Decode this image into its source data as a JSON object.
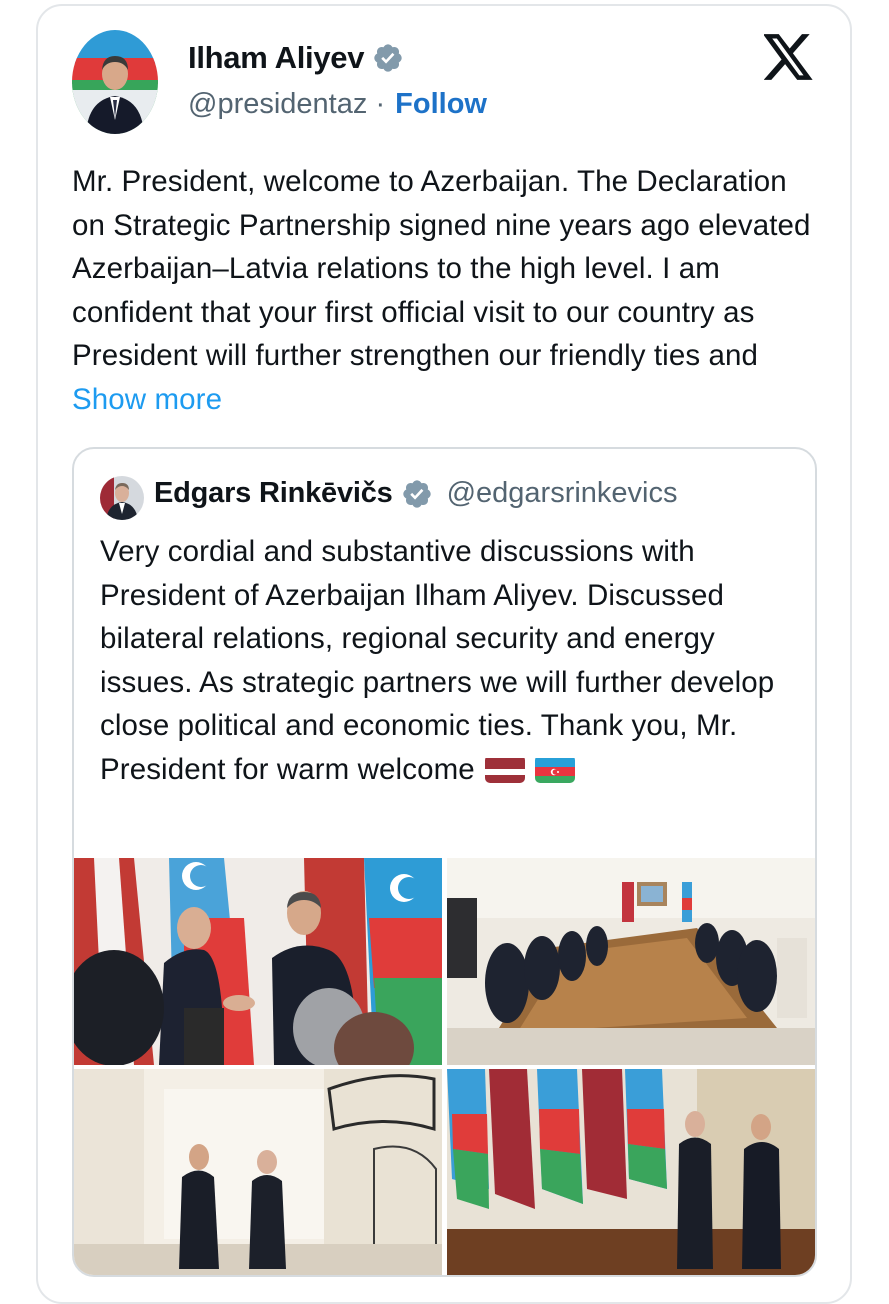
{
  "tweet": {
    "author_name": "Ilham Aliyev",
    "author_handle": "@presidentaz",
    "separator": "·",
    "follow_label": "Follow",
    "body": "Mr. President, welcome to Azerbaijan. The Declaration on Strategic Partnership signed nine years ago elevated Azerbaijan–Latvia relations to the high level. I am confident that your first official visit to our country as President will further strengthen our friendly ties and",
    "show_more_label": "Show more"
  },
  "quoted_tweet": {
    "author_name": "Edgars Rinkēvičs",
    "author_handle": "@edgarsrinkevics",
    "body": "Very cordial and substantive discussions with President of Azerbaijan Ilham Aliyev. Discussed bilateral relations, regional security and energy issues. As strategic partners we will further develop close political and economic ties. Thank you, Mr. President for warm welcome",
    "flag_emojis": [
      "flag-latvia",
      "flag-azerbaijan"
    ]
  },
  "icons": {
    "platform": "x-logo-icon",
    "verified": "verified-badge-icon"
  },
  "colors": {
    "link": "#1d9bf0",
    "follow": "#1d72c8",
    "verified_badge": "#829aab",
    "text": "#0f1419",
    "secondary_text": "#536471",
    "border": "#e3e6e9"
  }
}
